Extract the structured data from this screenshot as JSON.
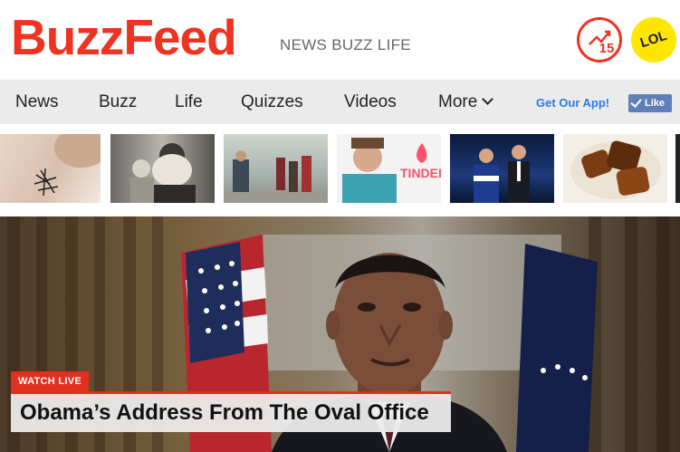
{
  "header": {
    "logo": "BuzzFeed",
    "tagline": "NEWS BUZZ LIFE",
    "trending_badge": "15",
    "lol_badge": "LOL"
  },
  "nav": {
    "items": [
      "News",
      "Buzz",
      "Life",
      "Quizzes",
      "Videos",
      "More"
    ],
    "app_link": "Get Our App!",
    "like_label": "Like"
  },
  "thumbs": {
    "tinder_label": "TINDER"
  },
  "hero": {
    "badge": "WATCH LIVE",
    "title": "Obama’s Address From The Oval Office"
  },
  "colors": {
    "brand": "#ee3322",
    "lol_yellow": "#ffe600",
    "app_link": "#2a7ae2",
    "like": "#5f7fb8"
  },
  "icons": [
    "trending-icon",
    "lol-icon",
    "chevron-down-icon",
    "like-check-icon"
  ]
}
